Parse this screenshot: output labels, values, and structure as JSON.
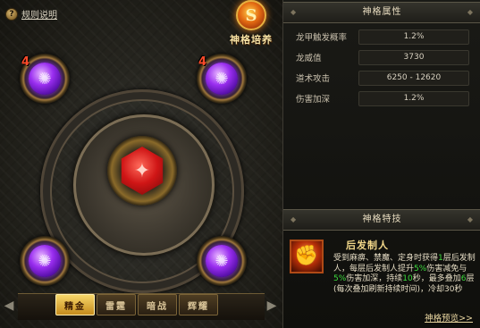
{
  "left_panel": {
    "rules_icon": "question-icon",
    "rules_label": "规则说明",
    "emblem_glyph": "S",
    "emblem_title": "神格培养",
    "center_gem_glyph": "✦",
    "slots": [
      {
        "level": "4",
        "glyph": "✺"
      },
      {
        "level": "4",
        "glyph": "✺"
      },
      {
        "level": "",
        "glyph": "✺"
      },
      {
        "level": "",
        "glyph": "✺"
      }
    ],
    "tabs": [
      {
        "label": "精金",
        "active": true
      },
      {
        "label": "雷霆",
        "active": false
      },
      {
        "label": "暗战",
        "active": false
      },
      {
        "label": "辉耀",
        "active": false
      }
    ],
    "arrow_left": "◀",
    "arrow_right": "▶"
  },
  "right_panel": {
    "attr_header": "神格属性",
    "attributes": [
      {
        "name": "龙甲触发概率",
        "value": "1.2%"
      },
      {
        "name": "龙威值",
        "value": "3730"
      },
      {
        "name": "道术攻击",
        "value": "6250 - 12620"
      },
      {
        "name": "伤害加深",
        "value": "1.2%"
      }
    ],
    "skill_header": "神格特技",
    "skill_icon": "fist-icon",
    "skill_name": "后发制人",
    "skill_desc": {
      "p1": "受到麻痹、禁魔、定身时获得",
      "n1": "1",
      "p2": "层后发制人，每层后发制人提升",
      "n2": "5%",
      "p3": "伤害减免与",
      "n3": "5%",
      "p4": "伤害加深，持续",
      "n4": "10",
      "p5": "秒，最多叠加",
      "n5": "6",
      "p6": "层(每次叠加刷新持续时间)，冷却30秒"
    },
    "preview_link": "神格预览>>"
  },
  "colors": {
    "accent_gold": "#f3d88a",
    "orb_purple": "#9a2ef0",
    "gem_red": "#d01616",
    "highlight_green": "#3edc3e"
  }
}
